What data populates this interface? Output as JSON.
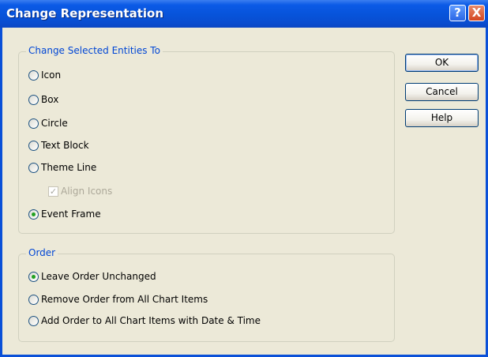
{
  "window": {
    "title": "Change Representation",
    "help_glyph": "?",
    "close_glyph": "X"
  },
  "group1": {
    "label": "Change Selected Entities To",
    "options": [
      {
        "label": "Icon",
        "checked": false
      },
      {
        "label": "Box",
        "checked": false
      },
      {
        "label": "Circle",
        "checked": false
      },
      {
        "label": "Text Block",
        "checked": false
      },
      {
        "label": "Theme Line",
        "checked": false
      },
      {
        "label": "Event Frame",
        "checked": true
      }
    ],
    "align_icons": {
      "label": "Align Icons",
      "checked": true,
      "disabled": true,
      "check_glyph": "✓"
    }
  },
  "group2": {
    "label": "Order",
    "options": [
      {
        "label": "Leave Order Unchanged",
        "checked": true
      },
      {
        "label": "Remove Order from All Chart Items",
        "checked": false
      },
      {
        "label": "Add Order to All Chart Items with Date & Time",
        "checked": false
      }
    ]
  },
  "buttons": {
    "ok": "OK",
    "cancel": "Cancel",
    "help": "Help"
  },
  "colors": {
    "titlebar": "#0753d9",
    "dialog_bg": "#ece9d8",
    "group_label": "#0046d5",
    "radio_dot": "#21a121"
  }
}
